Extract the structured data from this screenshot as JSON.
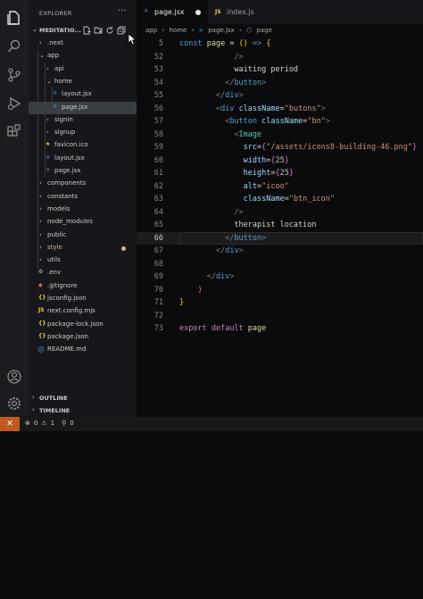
{
  "explorer": {
    "title": "EXPLORER",
    "more": "···",
    "project_label": "MEDITATIO...",
    "project_icons": [
      "new-file-icon",
      "new-folder-icon",
      "refresh-icon",
      "collapse-all-icon"
    ]
  },
  "tree": [
    {
      "label": ".next",
      "chev": "›",
      "indent": 1,
      "type": "folder"
    },
    {
      "label": "app",
      "chev": "⌄",
      "indent": 1,
      "type": "folder"
    },
    {
      "label": "api",
      "chev": "›",
      "indent": 2,
      "type": "folder"
    },
    {
      "label": "home",
      "chev": "⌄",
      "indent": 2,
      "type": "folder"
    },
    {
      "label": "layout.jsx",
      "indent": 3,
      "type": "file",
      "icon": "react"
    },
    {
      "label": "page.jsx",
      "indent": 3,
      "type": "file",
      "icon": "react",
      "selected": true
    },
    {
      "label": "signin",
      "chev": "›",
      "indent": 2,
      "type": "folder"
    },
    {
      "label": "signup",
      "chev": "›",
      "indent": 2,
      "type": "folder"
    },
    {
      "label": "favicon.ico",
      "indent": 2,
      "type": "file",
      "icon": "star"
    },
    {
      "label": "layout.jsx",
      "indent": 2,
      "type": "file",
      "icon": "react"
    },
    {
      "label": "page.jsx",
      "indent": 2,
      "type": "file",
      "icon": "react"
    },
    {
      "label": "components",
      "chev": "›",
      "indent": 1,
      "type": "folder"
    },
    {
      "label": "constants",
      "chev": "›",
      "indent": 1,
      "type": "folder"
    },
    {
      "label": "models",
      "chev": "›",
      "indent": 1,
      "type": "folder"
    },
    {
      "label": "node_modules",
      "chev": "›",
      "indent": 1,
      "type": "folder"
    },
    {
      "label": "public",
      "chev": "›",
      "indent": 1,
      "type": "folder"
    },
    {
      "label": "style",
      "chev": "›",
      "indent": 1,
      "type": "folder",
      "modified": true
    },
    {
      "label": "utils",
      "chev": "›",
      "indent": 1,
      "type": "folder"
    },
    {
      "label": ".env",
      "indent": 1,
      "type": "file",
      "icon": "env"
    },
    {
      "label": ".gitignore",
      "indent": 1,
      "type": "file",
      "icon": "git"
    },
    {
      "label": "jsconfig.json",
      "indent": 1,
      "type": "file",
      "icon": "json"
    },
    {
      "label": "next.config.mjs",
      "indent": 1,
      "type": "file",
      "icon": "js"
    },
    {
      "label": "package-lock.json",
      "indent": 1,
      "type": "file",
      "icon": "json"
    },
    {
      "label": "package.json",
      "indent": 1,
      "type": "file",
      "icon": "json"
    },
    {
      "label": "README.md",
      "indent": 1,
      "type": "file",
      "icon": "info"
    }
  ],
  "panels": {
    "outline": "OUTLINE",
    "timeline": "TIMELINE"
  },
  "tabs": [
    {
      "label": "page.jsx",
      "icon": "react",
      "active": true,
      "dirty": true
    },
    {
      "label": "index.js",
      "icon": "js",
      "active": false
    }
  ],
  "breadcrumb": [
    "app",
    "›",
    "home",
    "›",
    "page.jsx",
    "›",
    "page"
  ],
  "code": [
    {
      "n": "5",
      "tokens": [
        [
          "kw2",
          "const "
        ],
        [
          "fn",
          "page"
        ],
        [
          "txt",
          " = "
        ],
        [
          "yellow",
          "()"
        ],
        [
          "txt",
          " "
        ],
        [
          "kw2",
          "=>"
        ],
        [
          "txt",
          " "
        ],
        [
          "yellow",
          "{"
        ]
      ]
    },
    {
      "n": "52",
      "tokens": [
        [
          "txt",
          "            "
        ],
        [
          "ang",
          "/>"
        ]
      ]
    },
    {
      "n": "53",
      "tokens": [
        [
          "txt",
          "            waiting period"
        ]
      ]
    },
    {
      "n": "54",
      "tokens": [
        [
          "txt",
          "          "
        ],
        [
          "ang",
          "</"
        ],
        [
          "tag",
          "button"
        ],
        [
          "ang",
          ">"
        ]
      ]
    },
    {
      "n": "55",
      "tokens": [
        [
          "txt",
          "        "
        ],
        [
          "ang",
          "</"
        ],
        [
          "tag",
          "div"
        ],
        [
          "ang",
          ">"
        ]
      ]
    },
    {
      "n": "56",
      "tokens": [
        [
          "txt",
          "        "
        ],
        [
          "ang",
          "<"
        ],
        [
          "tag",
          "div"
        ],
        [
          "txt",
          " "
        ],
        [
          "attr",
          "className"
        ],
        [
          "txt",
          "="
        ],
        [
          "str",
          "\"butons\""
        ],
        [
          "ang",
          ">"
        ]
      ]
    },
    {
      "n": "57",
      "tokens": [
        [
          "txt",
          "          "
        ],
        [
          "ang",
          "<"
        ],
        [
          "tag",
          "button"
        ],
        [
          "txt",
          " "
        ],
        [
          "attr",
          "className"
        ],
        [
          "txt",
          "="
        ],
        [
          "str",
          "\"bn\""
        ],
        [
          "ang",
          ">"
        ]
      ]
    },
    {
      "n": "58",
      "tokens": [
        [
          "txt",
          "            "
        ],
        [
          "ang",
          "<"
        ],
        [
          "comp",
          "Image"
        ]
      ]
    },
    {
      "n": "59",
      "tokens": [
        [
          "txt",
          "              "
        ],
        [
          "attr",
          "src"
        ],
        [
          "txt",
          "="
        ],
        [
          "brace",
          "{"
        ],
        [
          "str",
          "\"/assets/icons8-building-46.png\""
        ],
        [
          "brace",
          "}"
        ]
      ]
    },
    {
      "n": "60",
      "tokens": [
        [
          "txt",
          "              "
        ],
        [
          "attr",
          "width"
        ],
        [
          "txt",
          "="
        ],
        [
          "brace",
          "{"
        ],
        [
          "num",
          "25"
        ],
        [
          "brace",
          "}"
        ]
      ]
    },
    {
      "n": "61",
      "tokens": [
        [
          "txt",
          "              "
        ],
        [
          "attr",
          "height"
        ],
        [
          "txt",
          "="
        ],
        [
          "brace",
          "{"
        ],
        [
          "num",
          "25"
        ],
        [
          "brace",
          "}"
        ]
      ]
    },
    {
      "n": "62",
      "tokens": [
        [
          "txt",
          "              "
        ],
        [
          "attr",
          "alt"
        ],
        [
          "txt",
          "="
        ],
        [
          "str",
          "\"icoo\""
        ]
      ]
    },
    {
      "n": "63",
      "tokens": [
        [
          "txt",
          "              "
        ],
        [
          "attr",
          "className"
        ],
        [
          "txt",
          "="
        ],
        [
          "str",
          "\"btn_icon\""
        ]
      ]
    },
    {
      "n": "64",
      "tokens": [
        [
          "txt",
          "            "
        ],
        [
          "ang",
          "/>"
        ]
      ]
    },
    {
      "n": "65",
      "tokens": [
        [
          "txt",
          "            therapist location"
        ]
      ]
    },
    {
      "n": "66",
      "tokens": [
        [
          "txt",
          "          "
        ],
        [
          "ang",
          "</"
        ],
        [
          "tag",
          "button"
        ],
        [
          "ang",
          ">"
        ]
      ],
      "current": true
    },
    {
      "n": "67",
      "tokens": [
        [
          "txt",
          "        "
        ],
        [
          "ang",
          "</"
        ],
        [
          "tag",
          "div"
        ],
        [
          "ang",
          ">"
        ]
      ]
    },
    {
      "n": "68",
      "tokens": []
    },
    {
      "n": "69",
      "tokens": [
        [
          "txt",
          "      "
        ],
        [
          "ang",
          "</"
        ],
        [
          "tag",
          "div"
        ],
        [
          "ang",
          ">"
        ]
      ]
    },
    {
      "n": "70",
      "tokens": [
        [
          "txt",
          "    "
        ],
        [
          "brace",
          ")"
        ]
      ]
    },
    {
      "n": "71",
      "tokens": [
        [
          "yellow",
          "}"
        ]
      ]
    },
    {
      "n": "72",
      "tokens": []
    },
    {
      "n": "73",
      "tokens": [
        [
          "kw",
          "export"
        ],
        [
          "txt",
          " "
        ],
        [
          "kw",
          "default"
        ],
        [
          "txt",
          " "
        ],
        [
          "fn",
          "page"
        ]
      ]
    }
  ],
  "status": {
    "remote": "✕",
    "errors": "0",
    "warnings": "1",
    "ports": "0"
  },
  "colors": {
    "react": "#4fc1ff",
    "js": "#e8d44d",
    "json": "#e8d44d",
    "accent_remote": "#c25a1e"
  }
}
